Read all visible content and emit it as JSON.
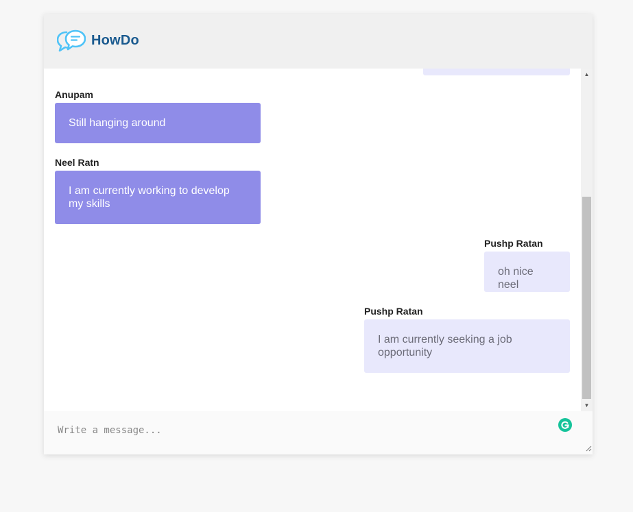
{
  "header": {
    "brand": "HowDo",
    "logo_icon": "chat-bubbles-icon",
    "brand_color": "#1a5a8f",
    "logo_color": "#4fc3f7"
  },
  "messages": [
    {
      "sender": "Anupam",
      "text": "Still hanging around",
      "direction": "incoming"
    },
    {
      "sender": "Neel Ratn",
      "text": "I am currently working to develop my skills",
      "direction": "incoming"
    },
    {
      "sender": "Pushp Ratan",
      "text": "oh nice neel",
      "direction": "outgoing"
    },
    {
      "sender": "Pushp Ratan",
      "text": "I am currently seeking a job opportunity",
      "direction": "outgoing"
    }
  ],
  "composer": {
    "placeholder": "Write a message...",
    "value": "",
    "grammar_icon": "grammarly-icon",
    "grammar_color": "#15c39a"
  },
  "colors": {
    "incoming_bubble": "#8f8ce8",
    "outgoing_bubble": "#e8e8fc",
    "header_bg": "#f0f0f0"
  }
}
